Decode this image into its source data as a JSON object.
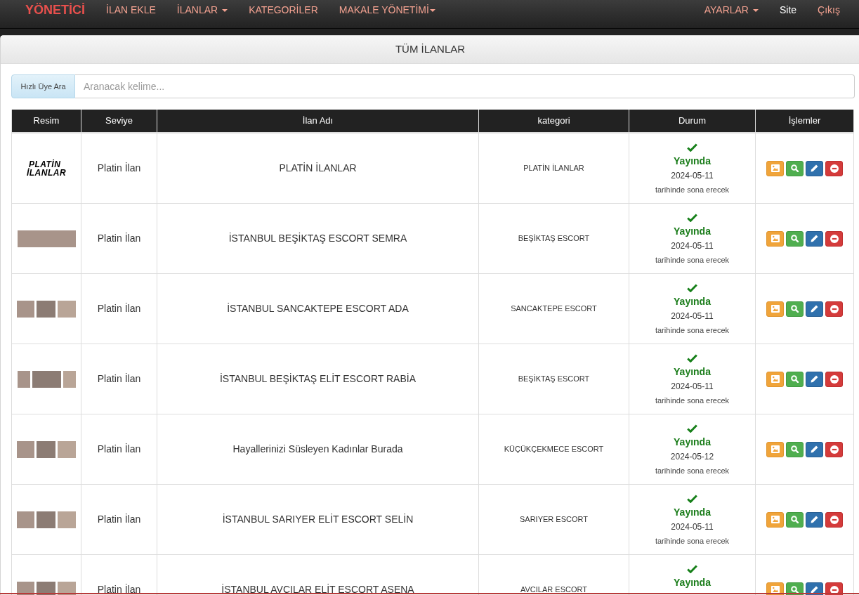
{
  "navbar": {
    "brand": "YÖNETİCİ",
    "menu": [
      {
        "label": "İLAN EKLE",
        "dropdown": false,
        "highlighted": false
      },
      {
        "label": "İLANLAR",
        "dropdown": true,
        "highlighted": false
      },
      {
        "label": "KATEGORİLER",
        "dropdown": false,
        "highlighted": false
      },
      {
        "label": "MAKALE YÖNETİMİ",
        "dropdown": true,
        "highlighted": false
      }
    ],
    "right_menu": [
      {
        "label": "AYARLAR",
        "dropdown": true,
        "highlighted": false
      },
      {
        "label": "Site",
        "dropdown": false,
        "highlighted": true
      },
      {
        "label": "Çıkış",
        "dropdown": false,
        "highlighted": false
      }
    ]
  },
  "panel": {
    "title": "TÜM İLANLAR"
  },
  "search": {
    "label": "Hızlı Üye Ara",
    "placeholder": "Aranacak kelime..."
  },
  "table": {
    "columns": [
      "Resim",
      "Seviye",
      "İlan Adı",
      "kategori",
      "Durum",
      "İşlemler"
    ],
    "actions": [
      {
        "kind": "images"
      },
      {
        "kind": "view"
      },
      {
        "kind": "edit"
      },
      {
        "kind": "delete"
      }
    ],
    "rows": [
      {
        "kind": "logo",
        "logo": [
          "PLATİN",
          "İLANLAR"
        ],
        "tier": "Platin İlan",
        "title": "PLATİN İLANLAR",
        "category": "PLATİN İLANLAR",
        "status": "Yayında",
        "expires": "2024-05-11",
        "expires_note": "tarihinde sona erecek"
      },
      {
        "kind": "wide",
        "tier": "Platin İlan",
        "title": "İSTANBUL BEŞİKTAŞ ESCORT SEMRA",
        "category": "BEŞİKTAŞ ESCORT",
        "status": "Yayında",
        "expires": "2024-05-11",
        "expires_note": "tarihinde sona erecek"
      },
      {
        "kind": "trio",
        "tier": "Platin İlan",
        "title": "İSTANBUL SANCAKTEPE ESCORT ADA",
        "category": "SANCAKTEPE ESCORT",
        "status": "Yayında",
        "expires": "2024-05-11",
        "expires_note": "tarihinde sona erecek"
      },
      {
        "kind": "mixed",
        "tier": "Platin İlan",
        "title": "İSTANBUL BEŞİKTAŞ ELİT ESCORT RABİA",
        "category": "BEŞİKTAŞ ESCORT",
        "status": "Yayında",
        "expires": "2024-05-11",
        "expires_note": "tarihinde sona erecek"
      },
      {
        "kind": "trio",
        "tier": "Platin İlan",
        "title": "Hayallerinizi Süsleyen Kadınlar Burada",
        "category": "KÜÇÜKÇEKMECE ESCORT",
        "status": "Yayında",
        "expires": "2024-05-12",
        "expires_note": "tarihinde sona erecek"
      },
      {
        "kind": "trio",
        "tier": "Platin İlan",
        "title": "İSTANBUL SARIYER ELİT ESCORT SELİN",
        "category": "SARIYER ESCORT",
        "status": "Yayında",
        "expires": "2024-05-11",
        "expires_note": "tarihinde sona erecek"
      },
      {
        "kind": "trio",
        "tier": "Platin İlan",
        "title": "İSTANBUL AVCILAR ELİT ESCORT ASENA",
        "category": "AVCILAR ESCORT",
        "status": "Yayında"
      }
    ]
  }
}
